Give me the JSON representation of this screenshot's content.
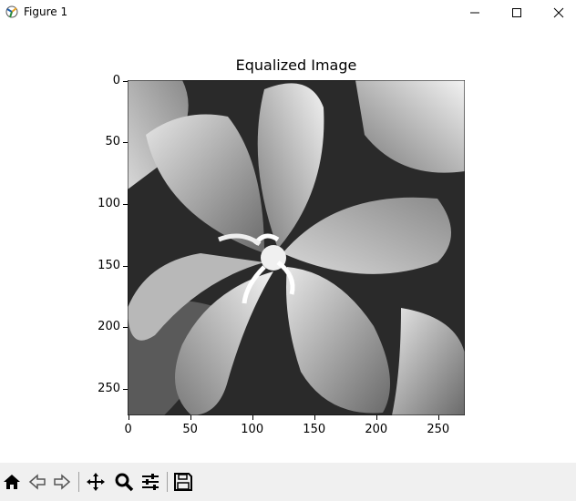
{
  "window": {
    "title": "Figure 1",
    "icon": "matplotlib-figure-icon",
    "controls": [
      "minimize-icon",
      "maximize-icon",
      "close-icon"
    ]
  },
  "plot": {
    "title": "Equalized Image",
    "image_description_icon": "grayscale-histogram-equalized-photo",
    "x_ticks": [
      "0",
      "50",
      "100",
      "150",
      "200",
      "250"
    ],
    "y_ticks": [
      "0",
      "50",
      "100",
      "150",
      "200",
      "250"
    ]
  },
  "toolbar": {
    "items": [
      {
        "name": "home-icon"
      },
      {
        "name": "back-icon"
      },
      {
        "name": "forward-icon"
      },
      {
        "name": "pan-icon"
      },
      {
        "name": "zoom-icon"
      },
      {
        "name": "configure-subplots-icon"
      },
      {
        "name": "save-icon"
      }
    ]
  }
}
